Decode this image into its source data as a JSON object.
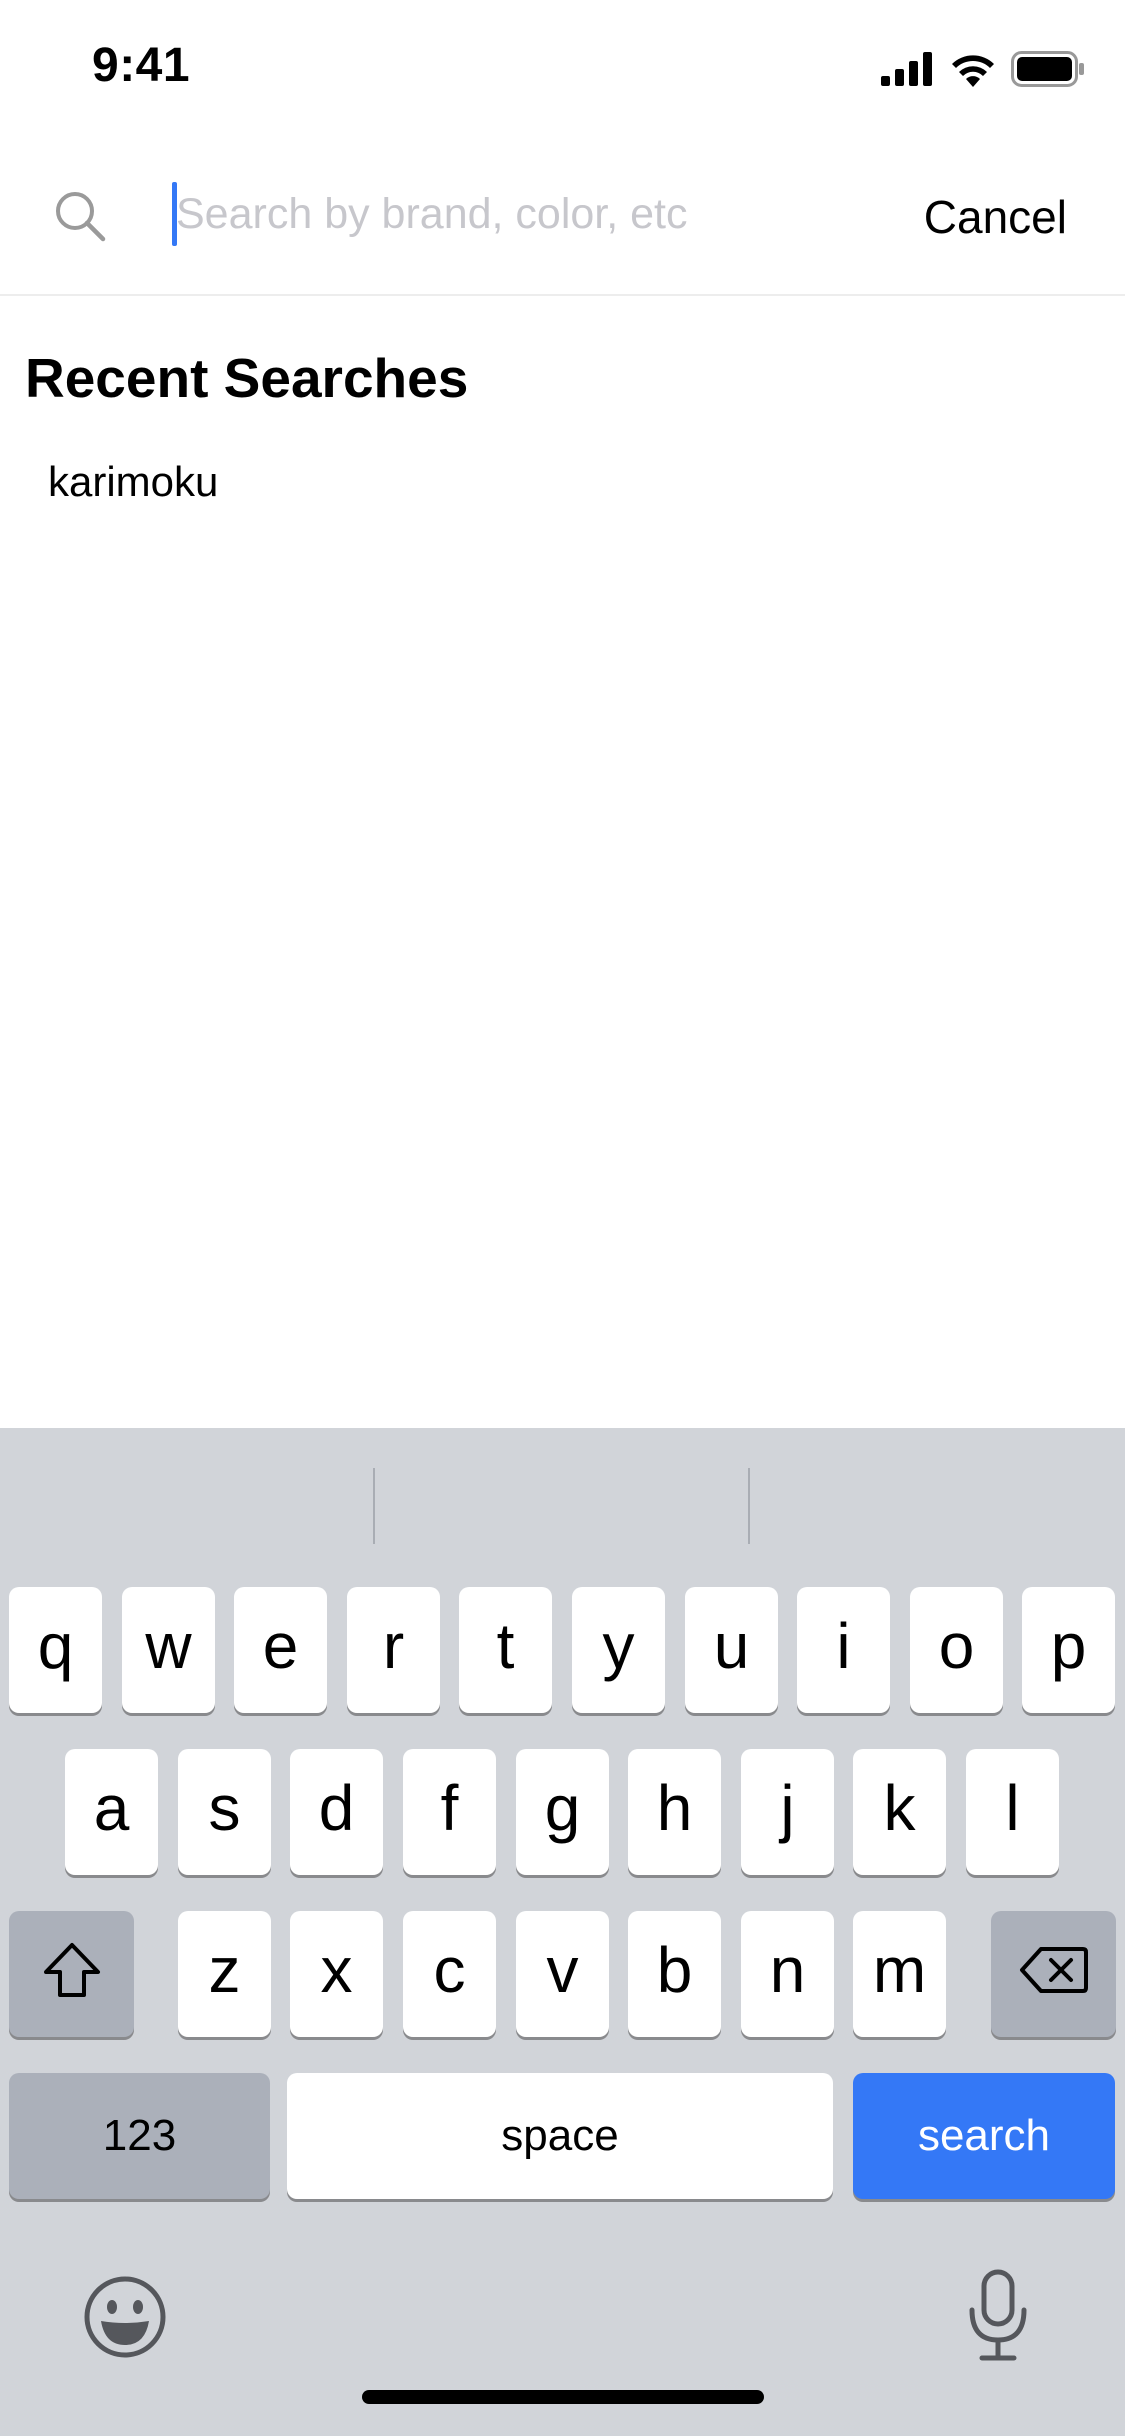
{
  "status_bar": {
    "time": "9:41"
  },
  "search": {
    "placeholder": "Search by brand, color, etc",
    "value": "",
    "cancel_label": "Cancel"
  },
  "recent": {
    "title": "Recent Searches",
    "items": [
      "karimoku"
    ]
  },
  "keyboard": {
    "row1": [
      "q",
      "w",
      "e",
      "r",
      "t",
      "y",
      "u",
      "i",
      "o",
      "p"
    ],
    "row2": [
      "a",
      "s",
      "d",
      "f",
      "g",
      "h",
      "j",
      "k",
      "l"
    ],
    "row3": [
      "z",
      "x",
      "c",
      "v",
      "b",
      "n",
      "m"
    ],
    "numbers_label": "123",
    "space_label": "space",
    "return_label": "search",
    "accent_color": "#3478f6"
  },
  "icons": {
    "status": [
      "cellular-signal-icon",
      "wifi-icon",
      "battery-icon"
    ],
    "search": "search-icon",
    "shift": "shift-icon",
    "delete": "delete-icon",
    "emoji": "emoji-icon",
    "microphone": "microphone-icon"
  }
}
